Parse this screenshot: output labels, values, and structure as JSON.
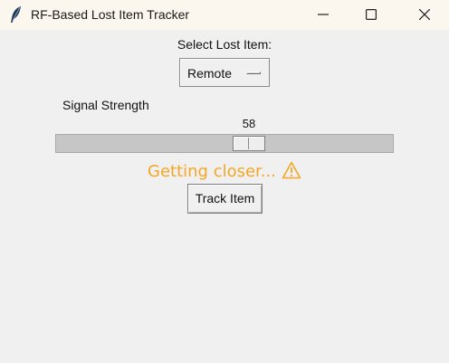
{
  "window": {
    "title": "RF-Based Lost Item Tracker",
    "icon": "feather-icon",
    "controls": [
      "minimize-icon",
      "maximize-icon",
      "close-icon"
    ]
  },
  "item_select": {
    "label": "Select Lost Item:",
    "selected": "Remote"
  },
  "signal": {
    "label": "Signal Strength",
    "value": "58",
    "level": 58,
    "min": 0,
    "max": 100
  },
  "status": {
    "text": "Getting closer...",
    "icon": "warning-icon",
    "color": "#f5a623"
  },
  "actions": {
    "track_label": "Track Item"
  }
}
